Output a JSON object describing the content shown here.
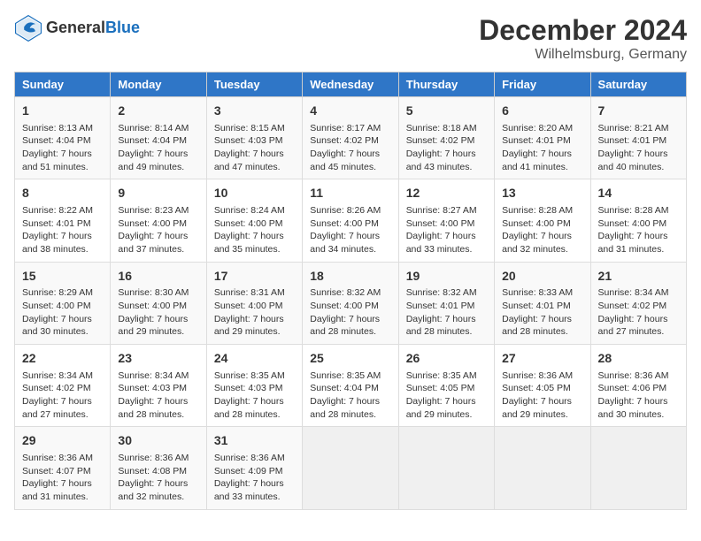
{
  "header": {
    "logo_general": "General",
    "logo_blue": "Blue",
    "month": "December 2024",
    "location": "Wilhelmsburg, Germany"
  },
  "weekdays": [
    "Sunday",
    "Monday",
    "Tuesday",
    "Wednesday",
    "Thursday",
    "Friday",
    "Saturday"
  ],
  "weeks": [
    [
      {
        "day": "1",
        "info": "Sunrise: 8:13 AM\nSunset: 4:04 PM\nDaylight: 7 hours\nand 51 minutes."
      },
      {
        "day": "2",
        "info": "Sunrise: 8:14 AM\nSunset: 4:04 PM\nDaylight: 7 hours\nand 49 minutes."
      },
      {
        "day": "3",
        "info": "Sunrise: 8:15 AM\nSunset: 4:03 PM\nDaylight: 7 hours\nand 47 minutes."
      },
      {
        "day": "4",
        "info": "Sunrise: 8:17 AM\nSunset: 4:02 PM\nDaylight: 7 hours\nand 45 minutes."
      },
      {
        "day": "5",
        "info": "Sunrise: 8:18 AM\nSunset: 4:02 PM\nDaylight: 7 hours\nand 43 minutes."
      },
      {
        "day": "6",
        "info": "Sunrise: 8:20 AM\nSunset: 4:01 PM\nDaylight: 7 hours\nand 41 minutes."
      },
      {
        "day": "7",
        "info": "Sunrise: 8:21 AM\nSunset: 4:01 PM\nDaylight: 7 hours\nand 40 minutes."
      }
    ],
    [
      {
        "day": "8",
        "info": "Sunrise: 8:22 AM\nSunset: 4:01 PM\nDaylight: 7 hours\nand 38 minutes."
      },
      {
        "day": "9",
        "info": "Sunrise: 8:23 AM\nSunset: 4:00 PM\nDaylight: 7 hours\nand 37 minutes."
      },
      {
        "day": "10",
        "info": "Sunrise: 8:24 AM\nSunset: 4:00 PM\nDaylight: 7 hours\nand 35 minutes."
      },
      {
        "day": "11",
        "info": "Sunrise: 8:26 AM\nSunset: 4:00 PM\nDaylight: 7 hours\nand 34 minutes."
      },
      {
        "day": "12",
        "info": "Sunrise: 8:27 AM\nSunset: 4:00 PM\nDaylight: 7 hours\nand 33 minutes."
      },
      {
        "day": "13",
        "info": "Sunrise: 8:28 AM\nSunset: 4:00 PM\nDaylight: 7 hours\nand 32 minutes."
      },
      {
        "day": "14",
        "info": "Sunrise: 8:28 AM\nSunset: 4:00 PM\nDaylight: 7 hours\nand 31 minutes."
      }
    ],
    [
      {
        "day": "15",
        "info": "Sunrise: 8:29 AM\nSunset: 4:00 PM\nDaylight: 7 hours\nand 30 minutes."
      },
      {
        "day": "16",
        "info": "Sunrise: 8:30 AM\nSunset: 4:00 PM\nDaylight: 7 hours\nand 29 minutes."
      },
      {
        "day": "17",
        "info": "Sunrise: 8:31 AM\nSunset: 4:00 PM\nDaylight: 7 hours\nand 29 minutes."
      },
      {
        "day": "18",
        "info": "Sunrise: 8:32 AM\nSunset: 4:00 PM\nDaylight: 7 hours\nand 28 minutes."
      },
      {
        "day": "19",
        "info": "Sunrise: 8:32 AM\nSunset: 4:01 PM\nDaylight: 7 hours\nand 28 minutes."
      },
      {
        "day": "20",
        "info": "Sunrise: 8:33 AM\nSunset: 4:01 PM\nDaylight: 7 hours\nand 28 minutes."
      },
      {
        "day": "21",
        "info": "Sunrise: 8:34 AM\nSunset: 4:02 PM\nDaylight: 7 hours\nand 27 minutes."
      }
    ],
    [
      {
        "day": "22",
        "info": "Sunrise: 8:34 AM\nSunset: 4:02 PM\nDaylight: 7 hours\nand 27 minutes."
      },
      {
        "day": "23",
        "info": "Sunrise: 8:34 AM\nSunset: 4:03 PM\nDaylight: 7 hours\nand 28 minutes."
      },
      {
        "day": "24",
        "info": "Sunrise: 8:35 AM\nSunset: 4:03 PM\nDaylight: 7 hours\nand 28 minutes."
      },
      {
        "day": "25",
        "info": "Sunrise: 8:35 AM\nSunset: 4:04 PM\nDaylight: 7 hours\nand 28 minutes."
      },
      {
        "day": "26",
        "info": "Sunrise: 8:35 AM\nSunset: 4:05 PM\nDaylight: 7 hours\nand 29 minutes."
      },
      {
        "day": "27",
        "info": "Sunrise: 8:36 AM\nSunset: 4:05 PM\nDaylight: 7 hours\nand 29 minutes."
      },
      {
        "day": "28",
        "info": "Sunrise: 8:36 AM\nSunset: 4:06 PM\nDaylight: 7 hours\nand 30 minutes."
      }
    ],
    [
      {
        "day": "29",
        "info": "Sunrise: 8:36 AM\nSunset: 4:07 PM\nDaylight: 7 hours\nand 31 minutes."
      },
      {
        "day": "30",
        "info": "Sunrise: 8:36 AM\nSunset: 4:08 PM\nDaylight: 7 hours\nand 32 minutes."
      },
      {
        "day": "31",
        "info": "Sunrise: 8:36 AM\nSunset: 4:09 PM\nDaylight: 7 hours\nand 33 minutes."
      },
      {
        "day": "",
        "info": ""
      },
      {
        "day": "",
        "info": ""
      },
      {
        "day": "",
        "info": ""
      },
      {
        "day": "",
        "info": ""
      }
    ]
  ]
}
